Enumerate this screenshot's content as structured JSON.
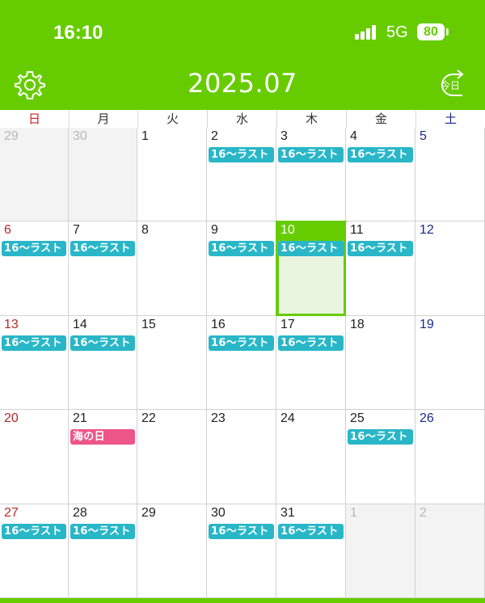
{
  "status_bar": {
    "time": "16:10",
    "network": "5G",
    "battery": "80"
  },
  "header": {
    "title": "2025.07",
    "settings_icon": "gear-icon",
    "today_label": "今日"
  },
  "weekdays": [
    "日",
    "月",
    "火",
    "水",
    "木",
    "金",
    "土"
  ],
  "colors": {
    "accent": "#66cc00",
    "event_teal": "#29b7c8",
    "event_pink": "#ee5588",
    "sunday": "#b82828",
    "saturday": "#1a2a8a"
  },
  "calendar": {
    "weeks": [
      [
        {
          "day": "29",
          "other": true
        },
        {
          "day": "30",
          "other": true
        },
        {
          "day": "1"
        },
        {
          "day": "2",
          "event": "16〜ラスト",
          "color": "teal"
        },
        {
          "day": "3",
          "event": "16〜ラスト",
          "color": "teal"
        },
        {
          "day": "4",
          "event": "16〜ラスト",
          "color": "teal"
        },
        {
          "day": "5"
        }
      ],
      [
        {
          "day": "6",
          "event": "16〜ラスト",
          "color": "teal"
        },
        {
          "day": "7",
          "event": "16〜ラスト",
          "color": "teal"
        },
        {
          "day": "8"
        },
        {
          "day": "9",
          "event": "16〜ラスト",
          "color": "teal"
        },
        {
          "day": "10",
          "event": "16〜ラスト",
          "color": "teal",
          "today": true
        },
        {
          "day": "11",
          "event": "16〜ラスト",
          "color": "teal"
        },
        {
          "day": "12"
        }
      ],
      [
        {
          "day": "13",
          "event": "16〜ラスト",
          "color": "teal"
        },
        {
          "day": "14",
          "event": "16〜ラスト",
          "color": "teal"
        },
        {
          "day": "15"
        },
        {
          "day": "16",
          "event": "16〜ラスト",
          "color": "teal"
        },
        {
          "day": "17",
          "event": "16〜ラスト",
          "color": "teal"
        },
        {
          "day": "18"
        },
        {
          "day": "19"
        }
      ],
      [
        {
          "day": "20"
        },
        {
          "day": "21",
          "event": "海の日",
          "color": "pink"
        },
        {
          "day": "22"
        },
        {
          "day": "23"
        },
        {
          "day": "24"
        },
        {
          "day": "25",
          "event": "16〜ラスト",
          "color": "teal"
        },
        {
          "day": "26"
        }
      ],
      [
        {
          "day": "27",
          "event": "16〜ラスト",
          "color": "teal"
        },
        {
          "day": "28",
          "event": "16〜ラスト",
          "color": "teal"
        },
        {
          "day": "29"
        },
        {
          "day": "30",
          "event": "16〜ラスト",
          "color": "teal"
        },
        {
          "day": "31",
          "event": "16〜ラスト",
          "color": "teal"
        },
        {
          "day": "1",
          "other": true
        },
        {
          "day": "2",
          "other": true
        }
      ]
    ]
  }
}
